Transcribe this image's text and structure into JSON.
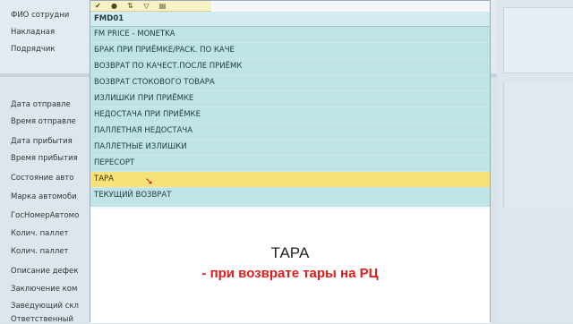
{
  "form": {
    "top_fields": [
      {
        "label": "ФИО сотрудни"
      },
      {
        "label": "Накладная"
      },
      {
        "label": "Подрядчик"
      }
    ],
    "fields": [
      {
        "label": "Дата отправле"
      },
      {
        "label": "Время отправле"
      },
      {
        "label": "Дата прибытия"
      },
      {
        "label": "Время прибытия"
      },
      {
        "label": "Состояние авто"
      },
      {
        "label": "Марка автомоби"
      },
      {
        "label": "ГосНомерАвтомо"
      },
      {
        "label": "Колич. паллет"
      },
      {
        "label": "Колич. паллет"
      },
      {
        "label": "Описание дефек"
      },
      {
        "label": "Заключение ком"
      },
      {
        "label": "Заведующий скл"
      },
      {
        "label": "Ответственный"
      }
    ]
  },
  "popup": {
    "toolbar_icons": [
      "check-icon",
      "info-icon",
      "sort-icon",
      "filter-icon",
      "export-icon"
    ],
    "list_header": "FMD01",
    "items": [
      {
        "label": "FM PRICE - MONETKA",
        "selected": false
      },
      {
        "label": "БРАК ПРИ ПРИЁМКЕ/PACK. ПО КАЧЕ",
        "selected": false
      },
      {
        "label": "ВОЗВРАТ ПО КАЧЕСТ.ПОСЛЕ ПРИЁМК",
        "selected": false
      },
      {
        "label": "ВОЗВРАТ СТОКОВОГО ТОВАРА",
        "selected": false
      },
      {
        "label": "ИЗЛИШКИ ПРИ ПРИЁМКЕ",
        "selected": false
      },
      {
        "label": "НЕДОСТАЧА ПРИ ПРИЁМКЕ",
        "selected": false
      },
      {
        "label": "ПАЛЛЕТНАЯ НЕДОСТАЧА",
        "selected": false
      },
      {
        "label": "ПАЛЛЕТНЫЕ ИЗЛИШКИ",
        "selected": false
      },
      {
        "label": "ПЕРЕСОРТ",
        "selected": false
      },
      {
        "label": "ТАРА",
        "selected": true
      },
      {
        "label": "ТЕКУЩИЙ ВОЗВРАТ",
        "selected": false
      }
    ],
    "caption_title": "ТАРА",
    "caption_subtitle": "- при возврате тары на РЦ"
  },
  "colors": {
    "list_bg": "#bfe3e7",
    "selected_bg": "#f7e27a",
    "caption_accent": "#e11b1b"
  }
}
